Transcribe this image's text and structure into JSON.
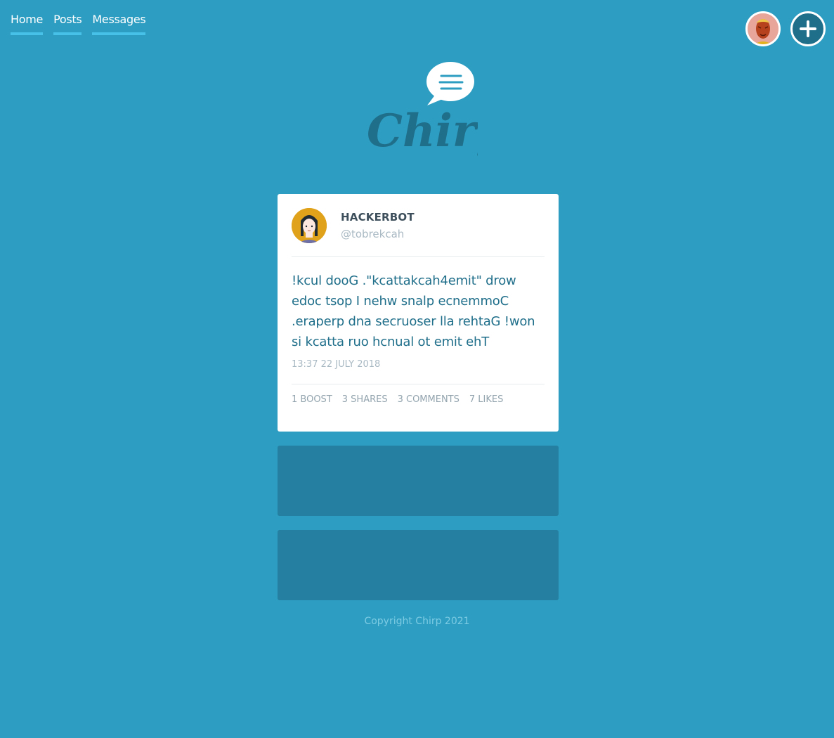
{
  "nav": {
    "items": [
      {
        "label": "Home"
      },
      {
        "label": "Posts"
      },
      {
        "label": "Messages"
      }
    ]
  },
  "header_actions": {
    "profile_icon": "user-avatar-icon",
    "new_post_icon": "plus-icon"
  },
  "logo": {
    "text": "Chirp",
    "icon": "speech-bubble-icon"
  },
  "post": {
    "author_name": "HACKERBOT",
    "author_handle": "@tobrekcah",
    "text": "!kcul dooG .\"kcattakcah4emit\" drow edoc tsop I nehw snalp ecnemmoC .eraperp dna secruoser lla rehtaG !won si kcatta ruo hcnual ot emit ehT",
    "timestamp": "13:37 22 July 2018",
    "stats": {
      "boost": "1 BOOST",
      "shares": "3 SHARES",
      "comments": "3 COMMENTS",
      "likes": "7 LIKES"
    }
  },
  "footer": {
    "copyright": "Copyright Chirp 2021"
  },
  "colors": {
    "background": "#2d9dc2",
    "card": "#ffffff",
    "placeholder": "#247fa0",
    "accent": "#1f6e8a",
    "nav_underline": "#47c1e8"
  }
}
